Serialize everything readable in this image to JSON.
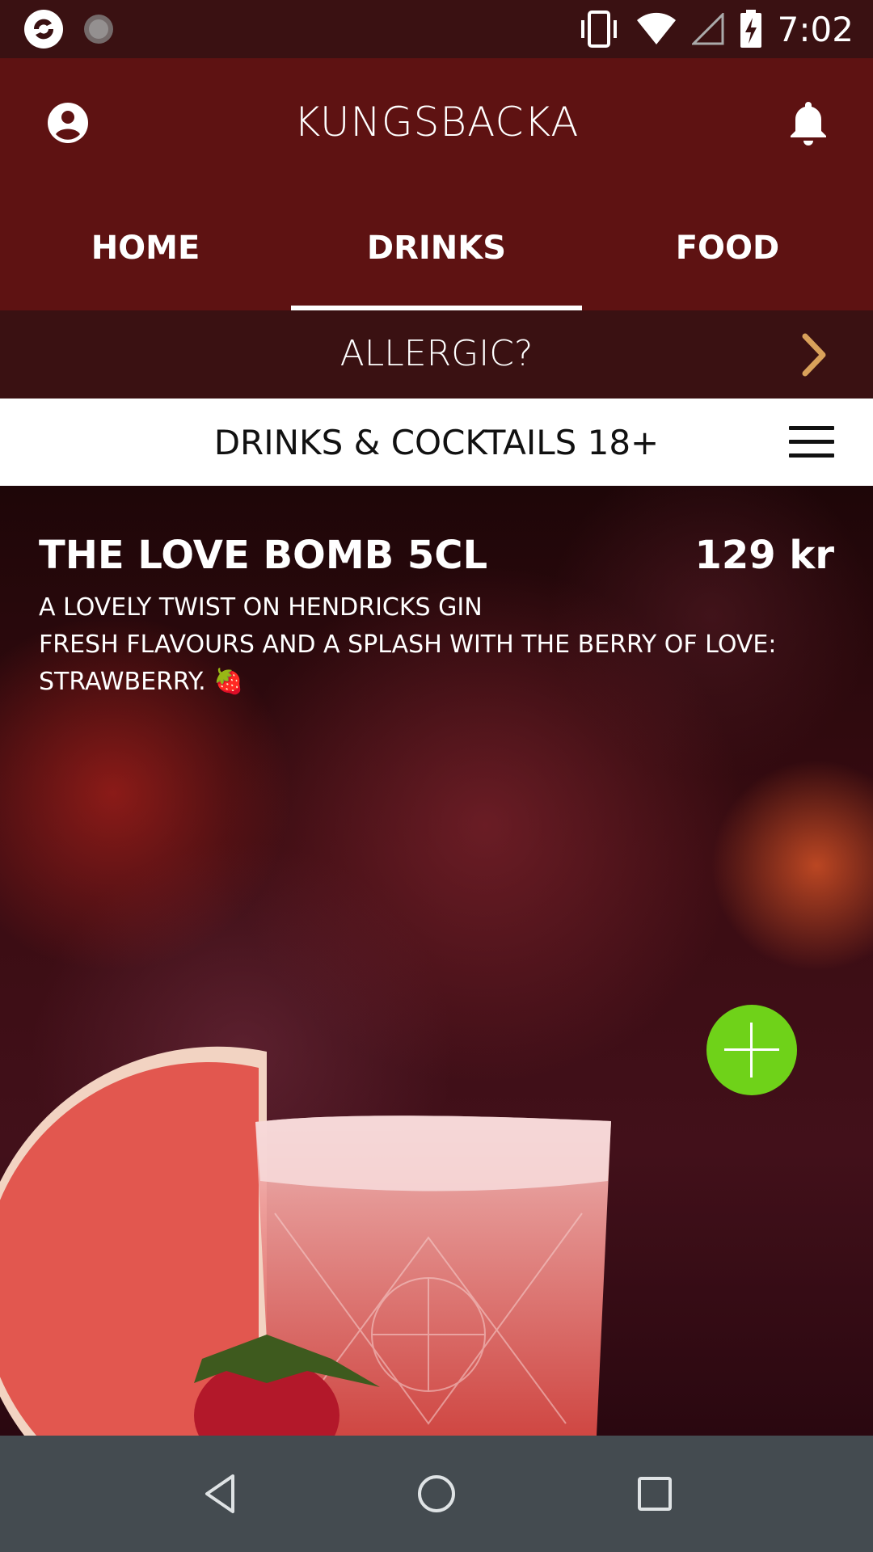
{
  "status_bar": {
    "time": "7:02"
  },
  "header": {
    "title": "KUNGSBACKA"
  },
  "tabs": [
    {
      "label": "HOME",
      "active": false
    },
    {
      "label": "DRINKS",
      "active": true
    },
    {
      "label": "FOOD",
      "active": false
    }
  ],
  "allergic": {
    "label": "ALLERGIC?"
  },
  "category": {
    "label": "DRINKS & COCKTAILS 18+"
  },
  "product": {
    "name": "THE LOVE BOMB 5CL",
    "price": "129 kr",
    "description_lines": [
      "A LOVELY TWIST ON HENDRICKS GIN",
      "FRESH FLAVOURS AND A SPLASH WITH THE BERRY OF LOVE:",
      "STRAWBERRY. 🍓"
    ]
  },
  "colors": {
    "header_bg": "#5e1212",
    "status_bg": "#3a1112",
    "accent_chevron": "#d9a15a",
    "add_button": "#6fd219",
    "nav_bg": "#444b50"
  },
  "icons": {
    "account": "account-circle-icon",
    "notifications": "bell-icon",
    "allergic_arrow": "chevron-right-icon",
    "menu": "hamburger-menu-icon",
    "add": "plus-icon"
  }
}
